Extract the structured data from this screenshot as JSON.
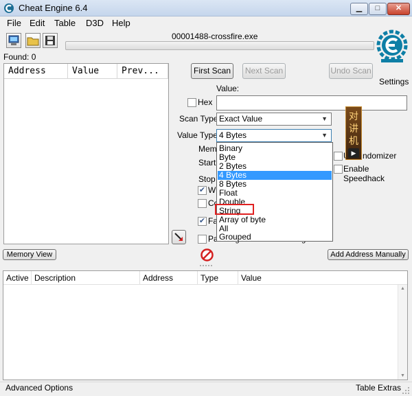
{
  "window": {
    "title": "Cheat Engine 6.4",
    "minimize": "▁",
    "maximize": "□",
    "close": "✕"
  },
  "menu": [
    "File",
    "Edit",
    "Table",
    "D3D",
    "Help"
  ],
  "toolbar": {
    "process_name": "00001488-crossfire.exe"
  },
  "found": "Found: 0",
  "settings_label": "Settings",
  "results_columns": [
    "Address",
    "Value",
    "Prev..."
  ],
  "buttons": {
    "first_scan": "First Scan",
    "next_scan": "Next Scan",
    "undo_scan": "Undo Scan",
    "memory_view": "Memory View",
    "add_address_manually": "Add Address Manually"
  },
  "scan": {
    "value_label": "Value:",
    "hex_label": "Hex",
    "scan_type_label": "Scan Type",
    "scan_type_value": "Exact Value",
    "value_type_label": "Value Type",
    "value_type_value": "4 Bytes",
    "value_type_options": [
      "Binary",
      "Byte",
      "2 Bytes",
      "4 Bytes",
      "8 Bytes",
      "Float",
      "Double",
      "String",
      "Array of byte",
      "All",
      "Grouped"
    ],
    "selected_option": "4 Bytes",
    "highlighted_option": "String"
  },
  "partial_labels": {
    "memo": "Memo",
    "start": "Start",
    "stop": "Stop",
    "wr": "W",
    "co": "Co",
    "fa": "Fa",
    "pause_tail": "Pa",
    "pause_visible_tail": "e the game while scanning",
    "unrandomizer_head": "U",
    "unrandomizer_tail": "ndomizer",
    "speedhack": "Enable Speedhack"
  },
  "ad_chars": [
    "对",
    "讲",
    "机"
  ],
  "address_table_columns": [
    "Active",
    "Description",
    "Address",
    "Type",
    "Value"
  ],
  "status": {
    "left": "Advanced Options",
    "right": "Table Extras"
  },
  "colors": {
    "selection": "#3399ff",
    "highlight_box": "#e02020",
    "logo": "#0e7fa6"
  }
}
